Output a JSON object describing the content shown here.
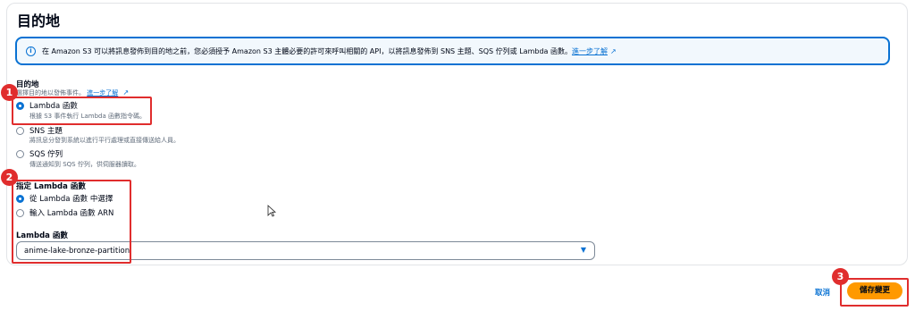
{
  "section": {
    "title": "目的地"
  },
  "info": {
    "text": "在 Amazon S3 可以將訊息發佈到目的地之前，您必須授予 Amazon S3 主體必要的許可來呼叫相關的 API，以將訊息發佈到 SNS 主題、SQS 佇列或 Lambda 函數。",
    "link": "進一步了解"
  },
  "destination": {
    "label": "目的地",
    "description": "選擇目的地以發佈事件。",
    "link": "進一步了解",
    "options": [
      {
        "label": "Lambda 函數",
        "description": "根據 S3 事件執行 Lambda 函數指令碼。",
        "selected": true
      },
      {
        "label": "SNS 主題",
        "description": "將訊息分發到系統以進行平行處理或直接傳送給人員。",
        "selected": false
      },
      {
        "label": "SQS 佇列",
        "description": "傳送通知到 SQS 佇列，供伺服器讀取。",
        "selected": false
      }
    ]
  },
  "lambda_spec": {
    "label": "指定 Lambda 函數",
    "options": [
      {
        "label": "從 Lambda 函數 中選擇",
        "selected": true
      },
      {
        "label": "輸入 Lambda 函數 ARN",
        "selected": false
      }
    ]
  },
  "lambda_select": {
    "label": "Lambda 函數",
    "value": "anime-lake-bronze-partition"
  },
  "footer": {
    "cancel": "取消",
    "save": "儲存變更"
  },
  "badges": [
    "1",
    "2",
    "3"
  ],
  "colors": {
    "accent": "#0972d3",
    "primary_button": "#ff9900",
    "annotation": "#e02d2d"
  }
}
